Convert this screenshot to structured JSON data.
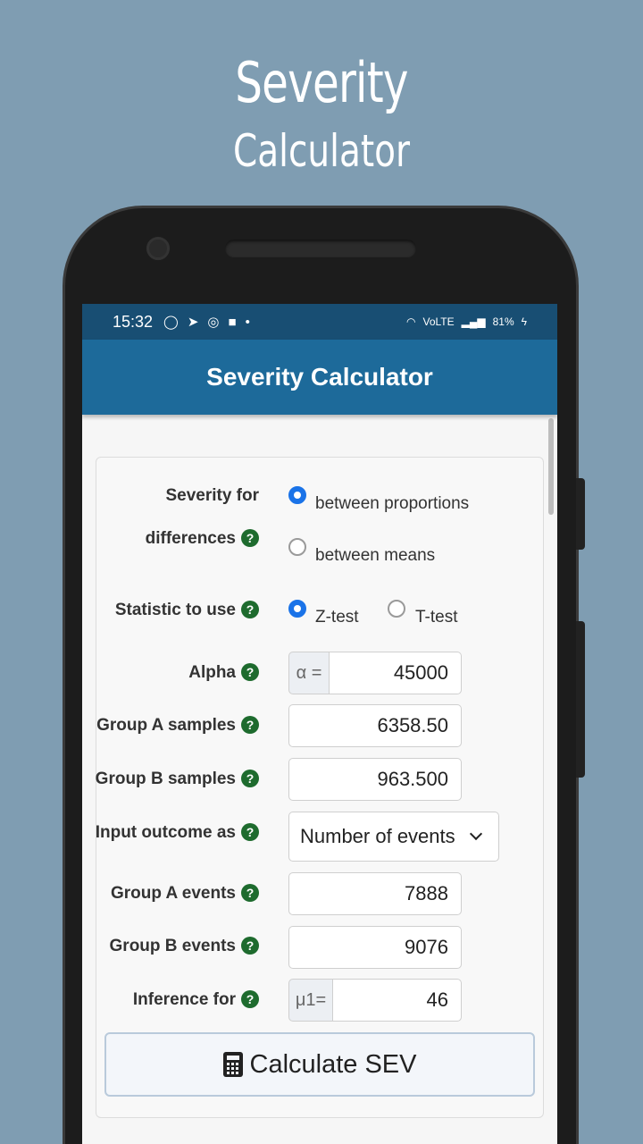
{
  "promo": {
    "line1": "Severity",
    "line2": "Calculator"
  },
  "status": {
    "time": "15:32",
    "battery": "81%",
    "network": "VoLTE"
  },
  "appbar": {
    "title": "Severity Calculator"
  },
  "form": {
    "severity_for": {
      "label_line1": "Severity for",
      "label_line2": "differences",
      "options": [
        "between proportions",
        "between means"
      ],
      "selected": 0
    },
    "statistic": {
      "label": "Statistic to use",
      "options": [
        "Z-test",
        "T-test"
      ],
      "selected": 0
    },
    "alpha": {
      "label": "Alpha",
      "addon": "α =",
      "value": "45000"
    },
    "group_a_samples": {
      "label": "Group A samples",
      "value": "6358.50"
    },
    "group_b_samples": {
      "label": "Group B samples",
      "value": "963.500"
    },
    "input_outcome": {
      "label": "Input outcome as",
      "value": "Number of events"
    },
    "group_a_events": {
      "label": "Group A events",
      "value": "7888"
    },
    "group_b_events": {
      "label": "Group B events",
      "value": "9076"
    },
    "inference": {
      "label": "Inference for",
      "addon": "μ1=",
      "value": "46"
    },
    "help_glyph": "?",
    "calculate_label": "Calculate SEV"
  },
  "colors": {
    "background": "#7f9db2",
    "statusbar": "#184e73",
    "appbar": "#1d6a9a",
    "help": "#1e6b2e",
    "radio": "#1a73e8"
  }
}
